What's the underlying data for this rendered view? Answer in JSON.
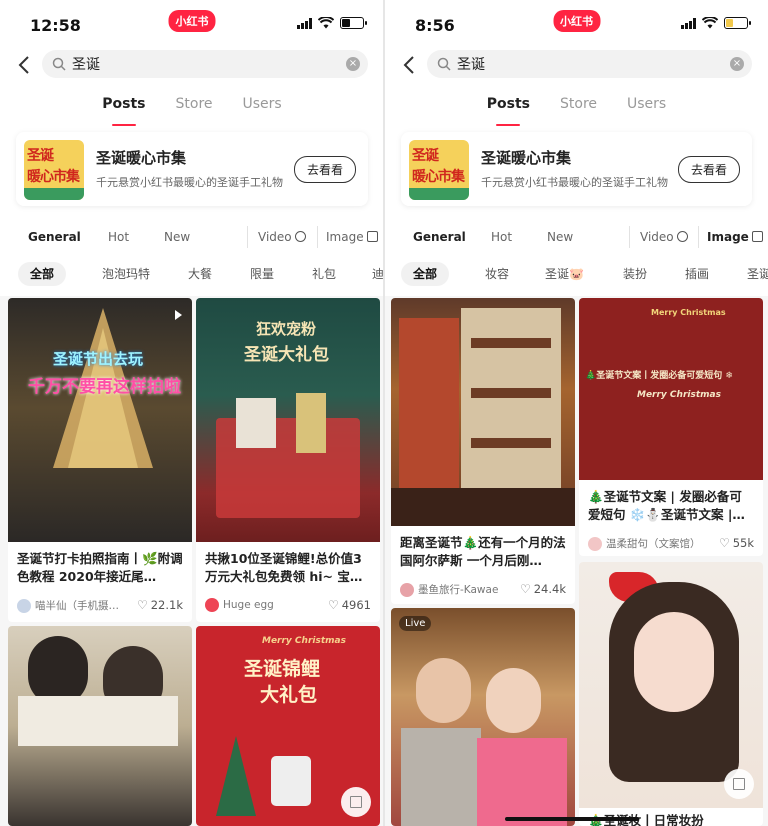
{
  "left": {
    "status": {
      "time": "12:58",
      "logo": "小红书"
    },
    "search": {
      "query": "圣诞"
    },
    "tabs": [
      "Posts",
      "Store",
      "Users"
    ],
    "banner": {
      "title": "圣诞暖心市集",
      "subtitle": "千元悬赏小红书最暖心的圣诞手工礼物",
      "button": "去看看",
      "thumb_line1": "圣诞",
      "thumb_line2": "暖心市集"
    },
    "filters": {
      "general": "General",
      "hot": "Hot",
      "new": "New",
      "video": "Video",
      "image": "Image"
    },
    "chips": [
      "全部",
      "泡泡玛特",
      "大餐",
      "限量",
      "礼包",
      "迪斯"
    ],
    "cards": [
      {
        "title": "圣诞节打卡拍照指南丨🌿附调色教程 2020年接近尾…",
        "author": "喵半仙（手机摄…",
        "likes": "22.1k",
        "overlay1": "圣诞节出去玩",
        "overlay2": "千万不要再这样拍啦"
      },
      {
        "title": "共揪10位圣诞锦鲤!总价值3万元大礼包免费领 hi~ 宝…",
        "author": "Huge egg",
        "likes": "4961",
        "overlay1": "狂欢宠粉",
        "overlay2": "圣诞大礼包"
      },
      {
        "title": "",
        "author": "",
        "likes": ""
      },
      {
        "title": "",
        "author": "",
        "likes": "",
        "overlay0": "Merry Christmas",
        "overlay1": "圣诞锦鲤",
        "overlay2": "大礼包"
      }
    ]
  },
  "right": {
    "status": {
      "time": "8:56",
      "logo": "小红书"
    },
    "search": {
      "query": "圣诞"
    },
    "tabs": [
      "Posts",
      "Store",
      "Users"
    ],
    "banner": {
      "title": "圣诞暖心市集",
      "subtitle": "千元悬赏小红书最暖心的圣诞手工礼物",
      "button": "去看看",
      "thumb_line1": "圣诞",
      "thumb_line2": "暖心市集"
    },
    "filters": {
      "general": "General",
      "hot": "Hot",
      "new": "New",
      "video": "Video",
      "image": "Image"
    },
    "chips": [
      "全部",
      "妆容",
      "圣诞🐷",
      "装扮",
      "插画",
      "圣诞"
    ],
    "cards": [
      {
        "title": "距离圣诞节🎄还有一个月的法国阿尔萨斯 一个月后刚…",
        "author": "墨鱼旅行-Kawae",
        "likes": "24.4k"
      },
      {
        "title": "🎄圣诞节文案 | 发圈必备可爱短句 ❄️⛄圣诞节文案 |…",
        "author": "温柔甜句（文案馆）",
        "likes": "55k",
        "overlay1": "🎄圣诞节文案丨发圈必备可爱短句 ❄",
        "overlay2": "Merry Christmas",
        "overlay0": "Merry Christmas"
      },
      {
        "title": "",
        "author": "",
        "likes": "",
        "live": "Live"
      },
      {
        "title": "🎄圣诞妆丨日常妆扮",
        "author": "",
        "likes": ""
      }
    ]
  },
  "colors": {
    "brand": "#ff2442",
    "feed_bg": "#f6f6f6"
  }
}
